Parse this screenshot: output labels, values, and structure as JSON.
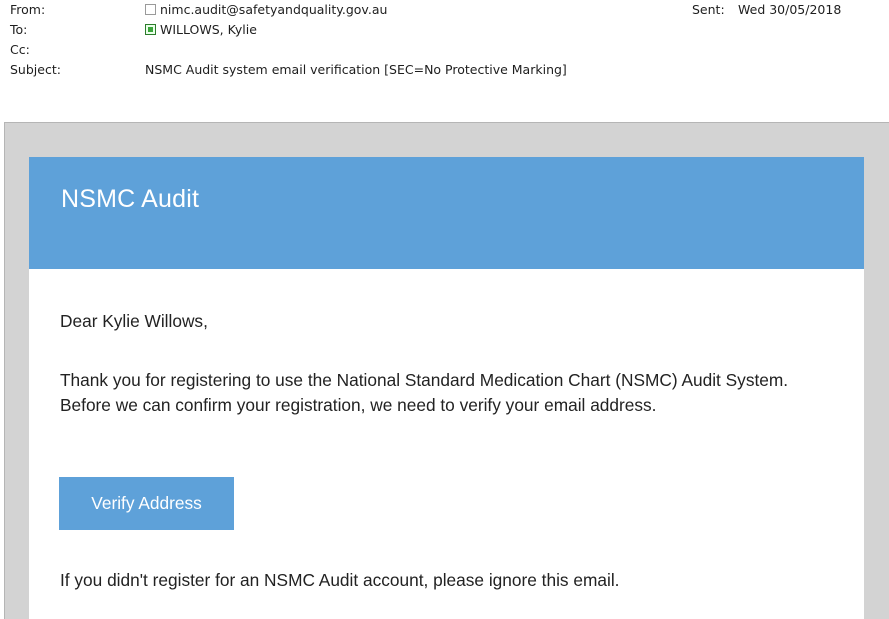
{
  "header": {
    "from_label": "From:",
    "from_value": "nimc.audit@safetyandquality.gov.au",
    "sent_label": "Sent:",
    "sent_value": "Wed 30/05/2018",
    "to_label": "To:",
    "to_value": "WILLOWS, Kylie",
    "cc_label": "Cc:",
    "cc_value": "",
    "subject_label": "Subject:",
    "subject_value": "NSMC Audit system email verification  [SEC=No Protective Marking]"
  },
  "email": {
    "banner_title": "NSMC Audit",
    "greeting": "Dear Kylie Willows,",
    "intro": "Thank you for registering to use the National Standard Medication Chart (NSMC) Audit System.  Before we can confirm your registration, we need to verify your email address.",
    "verify_button_label": "Verify Address",
    "ignore_note": "If you didn't register for an NSMC Audit account, please ignore this email."
  },
  "colors": {
    "banner": "#5ea1d9",
    "button": "#5ea1d9",
    "viewer_background": "#d3d3d3",
    "presence_online": "#3aa53a"
  },
  "icons": {
    "from_presence": "presence-unknown-icon",
    "to_presence": "presence-online-icon"
  }
}
